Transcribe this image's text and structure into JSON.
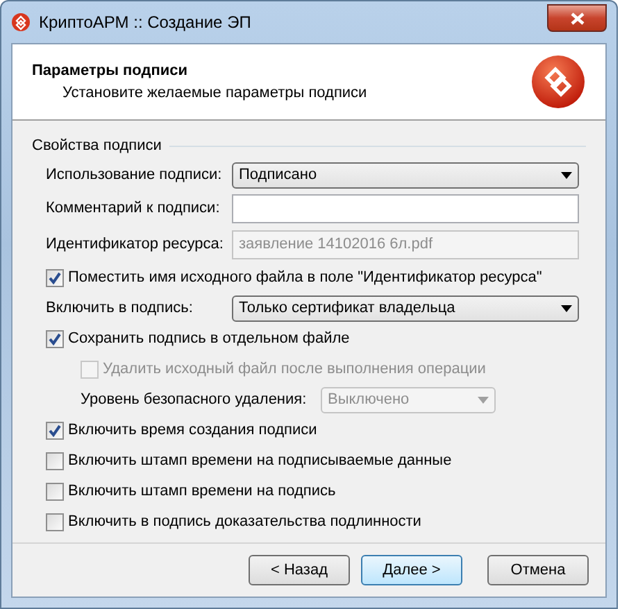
{
  "window": {
    "title": "КриптоАРМ :: Создание ЭП"
  },
  "header": {
    "title": "Параметры подписи",
    "subtitle": "Установите желаемые параметры подписи"
  },
  "group": {
    "title": "Свойства подписи",
    "items": [
      {
        "kind": "dropdown",
        "label": "Использование подписи:",
        "value": "Подписано",
        "disabled": false
      },
      {
        "kind": "text",
        "label": "Комментарий к подписи:",
        "disabled": false
      },
      {
        "kind": "text",
        "label": "Идентификатор ресурса:",
        "value": "заявление 14102016 6л.pdf",
        "disabled": true
      },
      {
        "kind": "checkbox",
        "label": "Поместить имя исходного файла в поле \"Идентификатор ресурса\"",
        "checked": true,
        "disabled": false
      },
      {
        "kind": "dropdown",
        "label": "Включить в подпись:",
        "value": "Только сертификат владельца",
        "disabled": false
      },
      {
        "kind": "checkbox",
        "label": "Сохранить подпись в отдельном файле",
        "checked": true,
        "disabled": false,
        "children": [
          {
            "kind": "checkbox",
            "label": "Удалить исходный файл после выполнения операции",
            "checked": false,
            "disabled": true
          },
          {
            "kind": "dropdown",
            "label": "Уровень безопасного удаления:",
            "value": "Выключено",
            "disabled": true
          }
        ]
      },
      {
        "kind": "checkbox",
        "label": "Включить время создания подписи",
        "checked": true,
        "disabled": false
      },
      {
        "kind": "checkbox",
        "label": "Включить штамп времени на подписываемые данные",
        "checked": false,
        "disabled": false
      },
      {
        "kind": "checkbox",
        "label": "Включить штамп времени на подпись",
        "checked": false,
        "disabled": false
      },
      {
        "kind": "checkbox",
        "label": "Включить в подпись доказательства подлинности",
        "checked": false,
        "disabled": false
      }
    ]
  },
  "buttons": [
    {
      "label": "< Назад",
      "default": false
    },
    {
      "label": "Далее >",
      "default": true
    },
    {
      "label": "Отмена",
      "default": false
    }
  ]
}
